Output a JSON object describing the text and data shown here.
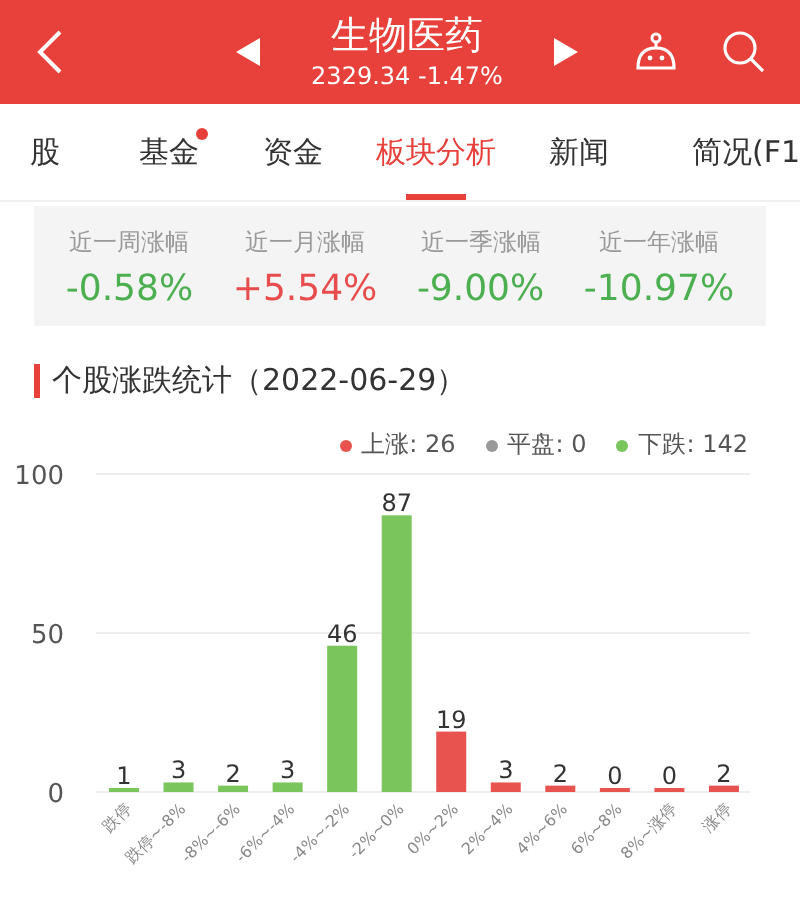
{
  "header": {
    "title": "生物医药",
    "subtitle": "2329.34 -1.47%"
  },
  "tabs": [
    {
      "label": "股",
      "selected": false,
      "badge": false
    },
    {
      "label": "基金",
      "selected": false,
      "badge": true
    },
    {
      "label": "资金",
      "selected": false,
      "badge": false
    },
    {
      "label": "板块分析",
      "selected": true,
      "badge": false
    },
    {
      "label": "新闻",
      "selected": false,
      "badge": false
    },
    {
      "label": "简况(F1",
      "selected": false,
      "badge": false
    }
  ],
  "stats": [
    {
      "label": "近一周涨幅",
      "value": "-0.58%",
      "color": "#4caf50"
    },
    {
      "label": "近一月涨幅",
      "value": "+5.54%",
      "color": "#e84c4c"
    },
    {
      "label": "近一季涨幅",
      "value": "-9.00%",
      "color": "#4caf50"
    },
    {
      "label": "近一年涨幅",
      "value": "-10.97%",
      "color": "#4caf50"
    }
  ],
  "section_title": "个股涨跌统计（2022-06-29）",
  "legend": [
    {
      "label": "上涨: 26",
      "color": "#e8534f"
    },
    {
      "label": "平盘: 0",
      "color": "#999999"
    },
    {
      "label": "下跌: 142",
      "color": "#7ac55c"
    }
  ],
  "chart": {
    "chart_data": {
      "type": "bar",
      "categories": [
        "跌停",
        "跌停~-8%",
        "-8%~-6%",
        "-6%~-4%",
        "-4%~-2%",
        "-2%~0%",
        "0%~2%",
        "2%~4%",
        "4%~6%",
        "6%~8%",
        "8%~涨停",
        "涨停"
      ],
      "series": [
        {
          "color": "#7ac55c",
          "values": [
            1,
            3,
            2,
            3,
            46,
            87,
            null,
            null,
            null,
            null,
            null,
            null
          ]
        },
        {
          "color": "#e8534f",
          "values": [
            null,
            null,
            null,
            null,
            null,
            null,
            19,
            3,
            2,
            0,
            0,
            2
          ]
        }
      ],
      "ylim": [
        0,
        100
      ],
      "yticks": [
        0,
        50,
        100
      ],
      "data_labels": true
    }
  }
}
